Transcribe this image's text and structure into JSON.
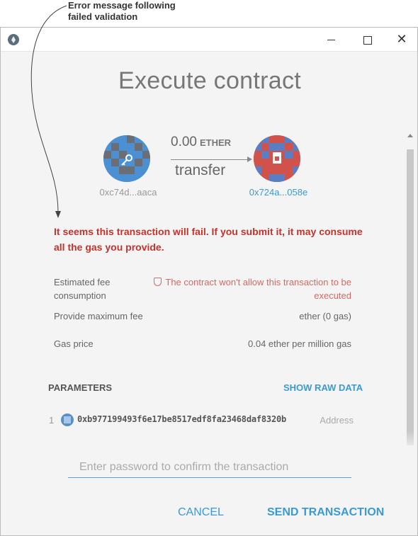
{
  "annotation": {
    "line1": "Error message following",
    "line2": "failed validation"
  },
  "window": {
    "close_glyph": "✕"
  },
  "page": {
    "title": "Execute contract"
  },
  "transfer": {
    "amount": "0.00",
    "unit": "ETHER",
    "method": "transfer",
    "from_address": "0xc74d...aaca",
    "to_address": "0x724a...058e"
  },
  "error": {
    "message": "It seems this transaction will fail. If you submit it, it may consume all the gas you provide."
  },
  "info": {
    "fee_label": "Estimated fee consumption",
    "fee_warning": "The contract won't allow this transaction to be executed",
    "max_fee_label": "Provide maximum fee",
    "max_fee_value": "ether (0 gas)",
    "gas_price_label": "Gas price",
    "gas_price_value": "0.04 ether per million gas"
  },
  "parameters": {
    "heading": "PARAMETERS",
    "show_raw": "SHOW RAW DATA",
    "items": [
      {
        "index": "1",
        "value": "0xb977199493f6e17be8517edf8fa23468daf8320b",
        "type": "Address"
      }
    ]
  },
  "password": {
    "placeholder": "Enter password to confirm the transaction"
  },
  "actions": {
    "cancel": "CANCEL",
    "send": "SEND TRANSACTION"
  },
  "colors": {
    "error": "#c5332d",
    "accent": "#3b9ad6",
    "warning": "#d36b63"
  }
}
